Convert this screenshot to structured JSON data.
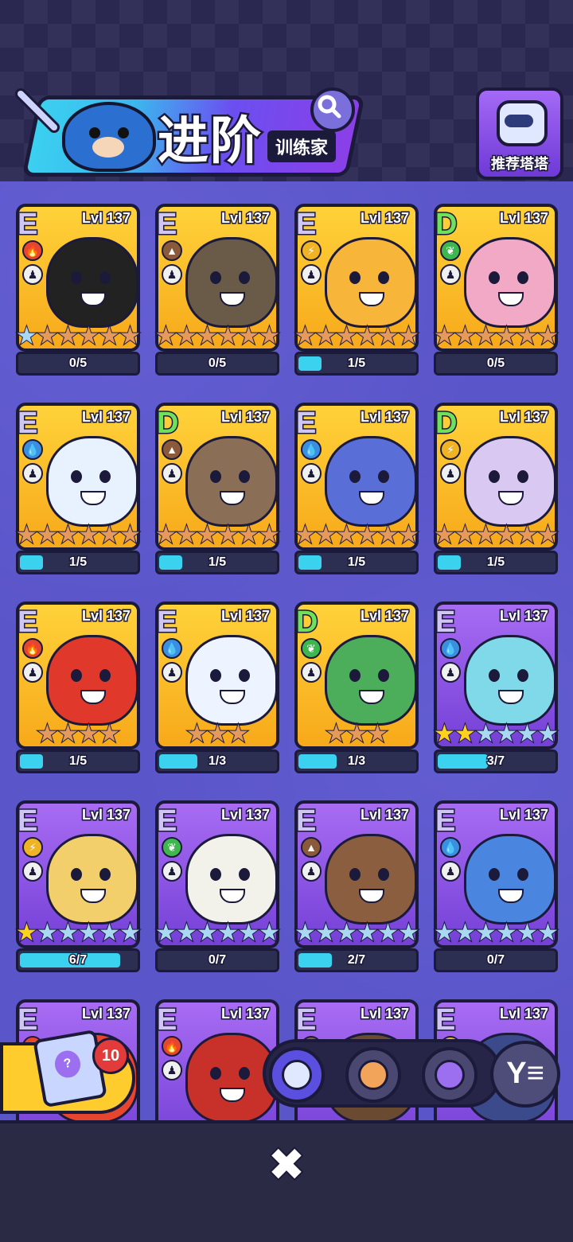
{
  "header": {
    "title": "进阶",
    "subtitle": "训练家",
    "recommend_label": "推荐塔塔"
  },
  "cards": [
    {
      "rank": "E",
      "level": "Lvl 137",
      "element": "fire",
      "color": "#e8452e",
      "theme": "gold",
      "stars": [
        "silver",
        "bronze",
        "bronze",
        "bronze",
        "bronze",
        "bronze"
      ],
      "progress": "0/5",
      "fill": 0.0,
      "art": "#222"
    },
    {
      "rank": "E",
      "level": "Lvl 137",
      "element": "earth",
      "color": "#8a5a3a",
      "theme": "gold",
      "stars": [
        "bronze",
        "bronze",
        "bronze",
        "bronze",
        "bronze",
        "bronze"
      ],
      "progress": "0/5",
      "fill": 0.0,
      "art": "#6a5a48"
    },
    {
      "rank": "E",
      "level": "Lvl 137",
      "element": "lightning",
      "color": "#f0b324",
      "theme": "gold",
      "stars": [
        "bronze",
        "bronze",
        "bronze",
        "bronze",
        "bronze",
        "bronze"
      ],
      "progress": "1/5",
      "fill": 0.2,
      "art": "#f7b53a"
    },
    {
      "rank": "D",
      "level": "Lvl 137",
      "element": "leaf",
      "color": "#3eb84e",
      "theme": "gold",
      "stars": [
        "bronze",
        "bronze",
        "bronze",
        "bronze",
        "bronze",
        "bronze"
      ],
      "progress": "0/5",
      "fill": 0.0,
      "art": "#f2a9c6"
    },
    {
      "rank": "E",
      "level": "Lvl 137",
      "element": "water",
      "color": "#3a8fe0",
      "theme": "gold",
      "stars": [
        "bronze",
        "bronze",
        "bronze",
        "bronze",
        "bronze",
        "bronze"
      ],
      "progress": "1/5",
      "fill": 0.2,
      "art": "#e8f2ff"
    },
    {
      "rank": "D",
      "level": "Lvl 137",
      "element": "earth",
      "color": "#8a5a3a",
      "theme": "gold",
      "stars": [
        "bronze",
        "bronze",
        "bronze",
        "bronze",
        "bronze",
        "bronze"
      ],
      "progress": "1/5",
      "fill": 0.2,
      "art": "#8a6e56"
    },
    {
      "rank": "E",
      "level": "Lvl 137",
      "element": "water",
      "color": "#3a8fe0",
      "theme": "gold",
      "stars": [
        "bronze",
        "bronze",
        "bronze",
        "bronze",
        "bronze",
        "bronze"
      ],
      "progress": "1/5",
      "fill": 0.2,
      "art": "#5a6ed8"
    },
    {
      "rank": "D",
      "level": "Lvl 137",
      "element": "lightning",
      "color": "#f0b324",
      "theme": "gold",
      "stars": [
        "bronze",
        "bronze",
        "bronze",
        "bronze",
        "bronze",
        "bronze"
      ],
      "progress": "1/5",
      "fill": 0.2,
      "art": "#d9c8f2"
    },
    {
      "rank": "E",
      "level": "Lvl 137",
      "element": "fire",
      "color": "#e8452e",
      "theme": "gold",
      "stars": [
        "bronze",
        "bronze",
        "bronze",
        "bronze"
      ],
      "progress": "1/5",
      "fill": 0.2,
      "art": "#e0382a"
    },
    {
      "rank": "E",
      "level": "Lvl 137",
      "element": "water",
      "color": "#3a8fe0",
      "theme": "gold",
      "stars": [
        "bronze",
        "bronze",
        "bronze"
      ],
      "progress": "1/3",
      "fill": 0.33,
      "art": "#eef4ff"
    },
    {
      "rank": "D",
      "level": "Lvl 137",
      "element": "leaf",
      "color": "#3eb84e",
      "theme": "gold",
      "stars": [
        "bronze",
        "bronze",
        "bronze"
      ],
      "progress": "1/3",
      "fill": 0.33,
      "art": "#4cae5a"
    },
    {
      "rank": "E",
      "level": "Lvl 137",
      "element": "water",
      "color": "#3a8fe0",
      "theme": "purple",
      "stars": [
        "gold",
        "gold",
        "silver",
        "silver",
        "silver",
        "silver"
      ],
      "progress": "3/7",
      "fill": 0.43,
      "art": "#7fd9e8"
    },
    {
      "rank": "E",
      "level": "Lvl 137",
      "element": "lightning",
      "color": "#f0b324",
      "theme": "purple",
      "stars": [
        "gold",
        "silver",
        "silver",
        "silver",
        "silver",
        "silver"
      ],
      "progress": "6/7",
      "fill": 0.86,
      "art": "#f2cf6a"
    },
    {
      "rank": "E",
      "level": "Lvl 137",
      "element": "leaf",
      "color": "#3eb84e",
      "theme": "purple",
      "stars": [
        "silver",
        "silver",
        "silver",
        "silver",
        "silver",
        "silver"
      ],
      "progress": "0/7",
      "fill": 0.0,
      "art": "#f2f2ea"
    },
    {
      "rank": "E",
      "level": "Lvl 137",
      "element": "earth",
      "color": "#8a5a3a",
      "theme": "purple",
      "stars": [
        "silver",
        "silver",
        "silver",
        "silver",
        "silver",
        "silver"
      ],
      "progress": "2/7",
      "fill": 0.29,
      "art": "#8a5e3e"
    },
    {
      "rank": "E",
      "level": "Lvl 137",
      "element": "water",
      "color": "#3a8fe0",
      "theme": "purple",
      "stars": [
        "silver",
        "silver",
        "silver",
        "silver",
        "silver",
        "silver"
      ],
      "progress": "0/7",
      "fill": 0.0,
      "art": "#4a86e0"
    },
    {
      "rank": "E",
      "level": "Lvl 137",
      "element": "fire",
      "color": "#e8452e",
      "theme": "purple",
      "stars": [],
      "progress": "",
      "fill": 0.0,
      "art": "#e8452e"
    },
    {
      "rank": "E",
      "level": "Lvl 137",
      "element": "fire",
      "color": "#e8452e",
      "theme": "purple",
      "stars": [],
      "progress": "",
      "fill": 0.0,
      "art": "#c8302a"
    },
    {
      "rank": "E",
      "level": "Lvl 137",
      "element": "earth",
      "color": "#8a5a3a",
      "theme": "purple",
      "stars": [],
      "progress": "",
      "fill": 0.0,
      "art": "#6a4a30"
    },
    {
      "rank": "E",
      "level": "Lvl 137",
      "element": "lightning",
      "color": "#f0b324",
      "theme": "purple",
      "stars": [],
      "progress": "",
      "fill": 0.0,
      "art": "#3a4a8a"
    }
  ],
  "dice": {
    "badge": "10",
    "glyph": "?"
  },
  "sort_icon": "filter-sort-icon",
  "close_glyph": "✖"
}
